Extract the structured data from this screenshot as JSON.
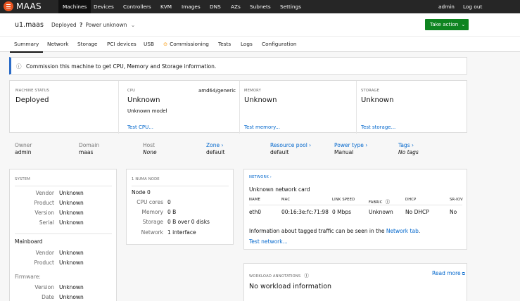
{
  "nav": {
    "brand": "MAAS",
    "items": [
      "Machines",
      "Devices",
      "Controllers",
      "KVM",
      "Images",
      "DNS",
      "AZs",
      "Subnets",
      "Settings"
    ],
    "user": "admin",
    "logout": "Log out"
  },
  "header": {
    "title": "u1.maas",
    "status": "Deployed",
    "power": "Power unknown",
    "take_action": "Take action"
  },
  "tabs": [
    "Summary",
    "Network",
    "Storage",
    "PCI devices",
    "USB",
    "Commissioning",
    "Tests",
    "Logs",
    "Configuration"
  ],
  "notice": "Commission this machine to get CPU, Memory and Storage information.",
  "overview": {
    "status_label": "MACHINE STATUS",
    "status": "Deployed",
    "cpu_label": "CPU",
    "cpu_arch": "amd64/generic",
    "cpu": "Unknown",
    "cpu_model": "Unknown model",
    "test_cpu": "Test CPU...",
    "mem_label": "MEMORY",
    "mem": "Unknown",
    "test_mem": "Test memory...",
    "storage_label": "STORAGE",
    "storage": "Unknown",
    "test_storage": "Test storage..."
  },
  "details": [
    {
      "label": "Owner",
      "value": "admin"
    },
    {
      "label": "Domain",
      "value": "maas"
    },
    {
      "label": "Host",
      "value": "None"
    },
    {
      "label": "Zone ›",
      "value": "default"
    },
    {
      "label": "Resource pool ›",
      "value": "default"
    },
    {
      "label": "Power type ›",
      "value": "Manual"
    },
    {
      "label": "Tags ›",
      "value": "No tags"
    }
  ],
  "system": {
    "title": "SYSTEM",
    "rows": [
      {
        "k": "Vendor",
        "v": "Unknown"
      },
      {
        "k": "Product",
        "v": "Unknown"
      },
      {
        "k": "Version",
        "v": "Unknown"
      },
      {
        "k": "Serial",
        "v": "Unknown"
      }
    ],
    "mainboard": "Mainboard",
    "mb_rows": [
      {
        "k": "Vendor",
        "v": "Unknown"
      },
      {
        "k": "Product",
        "v": "Unknown"
      }
    ],
    "firmware": "Firmware:",
    "fw_rows": [
      {
        "k": "Version",
        "v": "Unknown"
      },
      {
        "k": "Date",
        "v": "Unknown"
      }
    ]
  },
  "numa": {
    "title": "1 NUMA NODE",
    "node": "Node 0",
    "rows": [
      {
        "k": "CPU cores",
        "v": "0"
      },
      {
        "k": "Memory",
        "v": "0 B"
      },
      {
        "k": "Storage",
        "v": "0 B over 0 disks"
      },
      {
        "k": "Network",
        "v": "1 interface"
      }
    ]
  },
  "network": {
    "title": "NETWORK ›",
    "card": "Unknown network card",
    "headers": [
      "NAME",
      "MAC",
      "LINK SPEED",
      "FABRIC",
      "DHCP",
      "SR-IOV"
    ],
    "row": [
      "eth0",
      "00:16:3e:fc:71:98",
      "0 Mbps",
      "Unknown",
      "No DHCP",
      "No"
    ],
    "info_prefix": "Information about tagged traffic can be seen in the ",
    "info_link": "Network tab",
    "info_suffix": ".",
    "test": "Test network..."
  },
  "workload": {
    "title": "WORKLOAD ANNOTATIONS",
    "read_more": "Read more",
    "empty": "No workload information"
  }
}
